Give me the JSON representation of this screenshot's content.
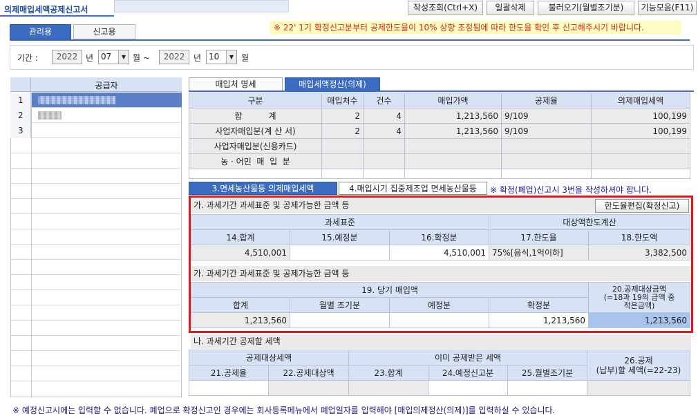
{
  "window": {
    "title": "의제매입세액공제신고서"
  },
  "toolbar": {
    "buttons": [
      {
        "label": "작성조회(Ctrl+X)"
      },
      {
        "label": "일괄삭제"
      },
      {
        "label": "불러오기(월별조기분)"
      },
      {
        "label": "기능모음(F11)"
      }
    ]
  },
  "mode_tabs": [
    {
      "label": "관리용"
    },
    {
      "label": "신고용"
    }
  ],
  "notice": "※ 22' 1기 확정신고분부터 공제한도율이 10% 상향 조정됨에 따라 한도율 확인 후 신고해주시기 바랍니다.",
  "period": {
    "label": "기간 :",
    "from_year": "2022",
    "from_month": "07",
    "to_year": "2022",
    "to_month": "10",
    "year_unit": "년",
    "month_unit_from": "월 ~",
    "month_unit_to": "월"
  },
  "supplier": {
    "header": "공급자",
    "rows": [
      {
        "no": "1"
      },
      {
        "no": "2"
      },
      {
        "no": "3"
      }
    ]
  },
  "section_tabs": [
    {
      "label": "매입처 명세"
    },
    {
      "label": "매입세액정산(의제)"
    }
  ],
  "summary": {
    "headers": [
      "구분",
      "매입처수",
      "건수",
      "매입가액",
      "공제율",
      "의제매입세액"
    ],
    "rows": [
      {
        "label": "합          계",
        "vendors": "2",
        "count": "4",
        "amount": "1,213,560",
        "rate": "9/109",
        "tax": "100,199"
      },
      {
        "label": "사업자매입분(계 산 서)",
        "vendors": "2",
        "count": "4",
        "amount": "1,213,560",
        "rate": "9/109",
        "tax": "100,199"
      },
      {
        "label": "사업자매입분(신용카드)",
        "vendors": "",
        "count": "",
        "amount": "",
        "rate": "",
        "tax": ""
      },
      {
        "label": "농 · 어민  매  입  분",
        "vendors": "",
        "count": "",
        "amount": "",
        "rate": "",
        "tax": ""
      }
    ]
  },
  "lower_tabs": [
    {
      "label": "3.면세농산물등 의제매입세액"
    },
    {
      "label": "4.매입시기 집중제조업 면세농산물등"
    }
  ],
  "lower_note": "※ 확정(폐업)신고시 3번을 작성하셔야 합니다.",
  "section_a": {
    "title": "가. 과세기간 과세표준 및 공제가능한 금액 등",
    "button": "한도율편집(확정신고)",
    "group1": "과세표준",
    "group2": "대상액한도계산",
    "cols": [
      "14.합계",
      "15.예정분",
      "16.확정분",
      "17.한도율",
      "18.한도액"
    ],
    "values": [
      "4,510,001",
      "",
      "4,510,001",
      "75%[음식,1억이하]",
      "3,382,500"
    ]
  },
  "section_a2": {
    "title": "가. 과세기간 과세표준 및 공제가능한 금액 등",
    "group": "19. 당기 매입액",
    "col20": "20.공제대상금액\n(=18과 19의 금액 중\n적은금액)",
    "cols": [
      "합계",
      "월별 조기분",
      "예정분",
      "확정분"
    ],
    "values": [
      "1,213,560",
      "",
      "",
      "1,213,560",
      "1,213,560"
    ]
  },
  "section_b": {
    "title": "나. 과세기간 공제할 세액",
    "group1": "공제대상세액",
    "group2": "이미 공제받은 세액",
    "col26": "26.공제\n(납부)할 세액(=22-23)",
    "cols": [
      "21.공제율",
      "22.공제대상액",
      "23.합계",
      "24.예정신고분",
      "25.월별조기분"
    ]
  },
  "footer": "※ 예정신고시에는 입력할 수 없습니다. 폐업으로 확정신고인 경우에는 회사등록메뉴에서 폐업일자를 입력해야 [매입의제정산(의제)]를 입력하실 수 있습니다."
}
